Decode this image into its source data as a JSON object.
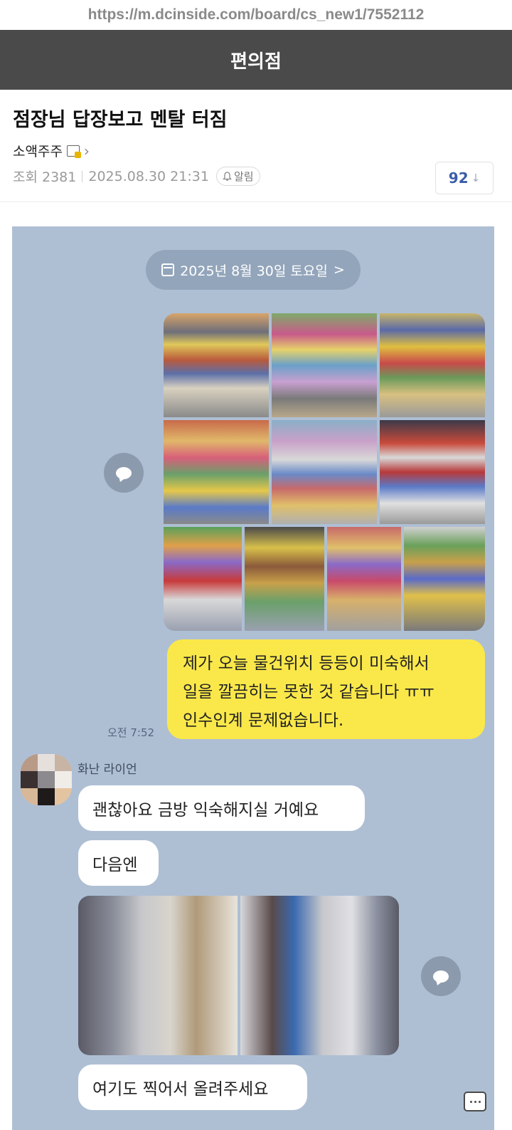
{
  "browser": {
    "url": "https://m.dcinside.com/board/cs_new1/7552112"
  },
  "board": {
    "name": "편의점"
  },
  "post": {
    "title": "점장님 답장보고 멘탈 터짐",
    "author": "소액주주",
    "views_label": "조회 2381",
    "datetime": "2025.08.30 21:31",
    "alarm_label": "알림",
    "vote_count": "92",
    "vote_arrow": "↓"
  },
  "chat": {
    "date_label": "2025년 8월 30일 토요일",
    "date_chevron": ">",
    "my_message_lines": [
      "제가 오늘 물건위치 등등이 미숙해서",
      "일을 깔끔히는 못한 것 같습니다 ㅠㅠ",
      "인수인계 문제없습니다."
    ],
    "my_message_time": "오전 7:52",
    "sender_name": "화난 라이언",
    "replies": [
      "괜찮아요 금방 익숙해지실 거예요",
      "다음엔",
      "여기도 찍어서 올려주세요"
    ]
  },
  "icons": {
    "calendar": "calendar-icon",
    "share": "share-bubble-icon",
    "bell": "bell-icon",
    "comment": "comment-icon"
  },
  "colors": {
    "header_bg": "#4a4a4a",
    "chat_bg": "#aebfd4",
    "my_bubble": "#fae84a",
    "vote_blue": "#3b5ea8"
  }
}
